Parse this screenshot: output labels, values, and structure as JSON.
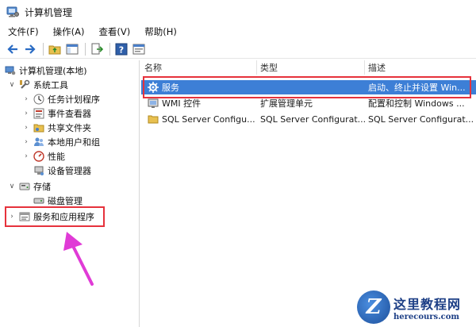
{
  "window": {
    "title": "计算机管理"
  },
  "menu": [
    {
      "label": "文件(F)"
    },
    {
      "label": "操作(A)"
    },
    {
      "label": "查看(V)"
    },
    {
      "label": "帮助(H)"
    }
  ],
  "toolbar": {
    "icons": [
      "back-arrow-icon",
      "forward-arrow-icon",
      "up-folder-icon",
      "show-hide-tree-icon",
      "export-list-icon",
      "help-icon",
      "properties-icon"
    ]
  },
  "tree": {
    "root": "计算机管理(本地)",
    "items": [
      {
        "label": "系统工具",
        "icon": "tools-icon"
      },
      {
        "label": "任务计划程序",
        "icon": "clock-icon"
      },
      {
        "label": "事件查看器",
        "icon": "event-viewer-icon"
      },
      {
        "label": "共享文件夹",
        "icon": "shared-folder-icon"
      },
      {
        "label": "本地用户和组",
        "icon": "users-icon"
      },
      {
        "label": "性能",
        "icon": "performance-icon"
      },
      {
        "label": "设备管理器",
        "icon": "device-manager-icon"
      },
      {
        "label": "存储",
        "icon": "storage-icon"
      },
      {
        "label": "磁盘管理",
        "icon": "disk-icon"
      },
      {
        "label": "服务和应用程序",
        "icon": "services-apps-icon"
      }
    ]
  },
  "list": {
    "columns": [
      "名称",
      "类型",
      "描述"
    ],
    "rows": [
      {
        "name": "服务",
        "type": "",
        "description": "启动、终止并设置 Win...",
        "icon": "gear-icon",
        "selected": true
      },
      {
        "name": "WMI 控件",
        "type": "扩展管理单元",
        "description": "配置和控制 Windows ...",
        "icon": "wmi-icon",
        "selected": false
      },
      {
        "name": "SQL Server Configu...",
        "type": "SQL Server Configurat...",
        "description": "SQL Server Configurat...",
        "icon": "folder-icon",
        "selected": false
      }
    ]
  },
  "watermark": {
    "logo_letter": "Z",
    "text": "这里教程网",
    "url": "herecours.com"
  },
  "colors": {
    "selection": "#3d7fd6",
    "highlight_box": "#e6323c",
    "arrow": "#e03bd6"
  }
}
